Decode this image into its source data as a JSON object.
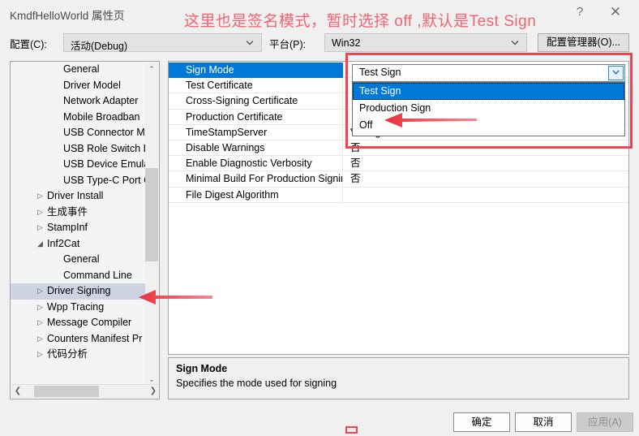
{
  "window": {
    "title": "KmdfHelloWorld 属性页",
    "help_icon": "?",
    "close_icon": "✕"
  },
  "config_bar": {
    "config_label": "配置(C):",
    "config_value": "活动(Debug)",
    "platform_label": "平台(P):",
    "platform_value": "Win32",
    "config_manager_button": "配置管理器(O)..."
  },
  "tree": {
    "nodes": [
      {
        "label": "General",
        "level": 2,
        "expander": "",
        "selected": false
      },
      {
        "label": "Driver Model",
        "level": 2,
        "expander": "",
        "selected": false
      },
      {
        "label": "Network Adapter",
        "level": 2,
        "expander": "",
        "selected": false
      },
      {
        "label": "Mobile Broadban",
        "level": 2,
        "expander": "",
        "selected": false
      },
      {
        "label": "USB Connector M",
        "level": 2,
        "expander": "",
        "selected": false
      },
      {
        "label": "USB Role Switch D",
        "level": 2,
        "expander": "",
        "selected": false
      },
      {
        "label": "USB Device Emula",
        "level": 2,
        "expander": "",
        "selected": false
      },
      {
        "label": "USB Type-C Port C",
        "level": 2,
        "expander": "",
        "selected": false
      },
      {
        "label": "Driver Install",
        "level": 1,
        "expander": "▷",
        "selected": false
      },
      {
        "label": "生成事件",
        "level": 1,
        "expander": "▷",
        "selected": false
      },
      {
        "label": "StampInf",
        "level": 1,
        "expander": "▷",
        "selected": false
      },
      {
        "label": "Inf2Cat",
        "level": 1,
        "expander": "◢",
        "selected": false
      },
      {
        "label": "General",
        "level": 2,
        "expander": "",
        "selected": false
      },
      {
        "label": "Command Line",
        "level": 2,
        "expander": "",
        "selected": false
      },
      {
        "label": "Driver Signing",
        "level": 1,
        "expander": "▷",
        "selected": true
      },
      {
        "label": "Wpp Tracing",
        "level": 1,
        "expander": "▷",
        "selected": false
      },
      {
        "label": "Message Compiler",
        "level": 1,
        "expander": "▷",
        "selected": false
      },
      {
        "label": "Counters Manifest Pr",
        "level": 1,
        "expander": "▷",
        "selected": false
      },
      {
        "label": "代码分析",
        "level": 1,
        "expander": "▷",
        "selected": false
      }
    ],
    "scroll_up_icon": "⌃",
    "scroll_down_icon": "⌄",
    "scroll_left_icon": "❮",
    "scroll_right_icon": "❯"
  },
  "grid": {
    "rows": [
      {
        "name": "Sign Mode",
        "value": "",
        "selected": true
      },
      {
        "name": "Test Certificate",
        "value": "",
        "selected": false
      },
      {
        "name": "Cross-Signing Certificate",
        "value": "",
        "selected": false
      },
      {
        "name": "Production Certificate",
        "value": "",
        "selected": false
      },
      {
        "name": "TimeStampServer",
        "value": "Verisign",
        "selected": false
      },
      {
        "name": "Disable Warnings",
        "value": "否",
        "selected": false
      },
      {
        "name": "Enable Diagnostic Verbosity",
        "value": "否",
        "selected": false
      },
      {
        "name": "Minimal Build For Production Signing",
        "value": "否",
        "selected": false
      },
      {
        "name": "File Digest Algorithm",
        "value": "",
        "selected": false
      }
    ]
  },
  "editor": {
    "current_value": "Test Sign",
    "dropdown_arrow_icon": "⌄",
    "options": [
      {
        "label": "Test Sign",
        "selected": true
      },
      {
        "label": "Production Sign",
        "selected": false
      },
      {
        "label": "Off",
        "selected": false
      }
    ]
  },
  "description": {
    "title": "Sign Mode",
    "text": "Specifies the mode used for signing"
  },
  "footer": {
    "ok": "确定",
    "cancel": "取消",
    "apply": "应用(A)"
  },
  "annotations": {
    "note": "这里也是签名模式，暂时选择 off ,默认是Test Sign",
    "highlight_color": "#ef4452",
    "note_color": "#f4636f"
  }
}
